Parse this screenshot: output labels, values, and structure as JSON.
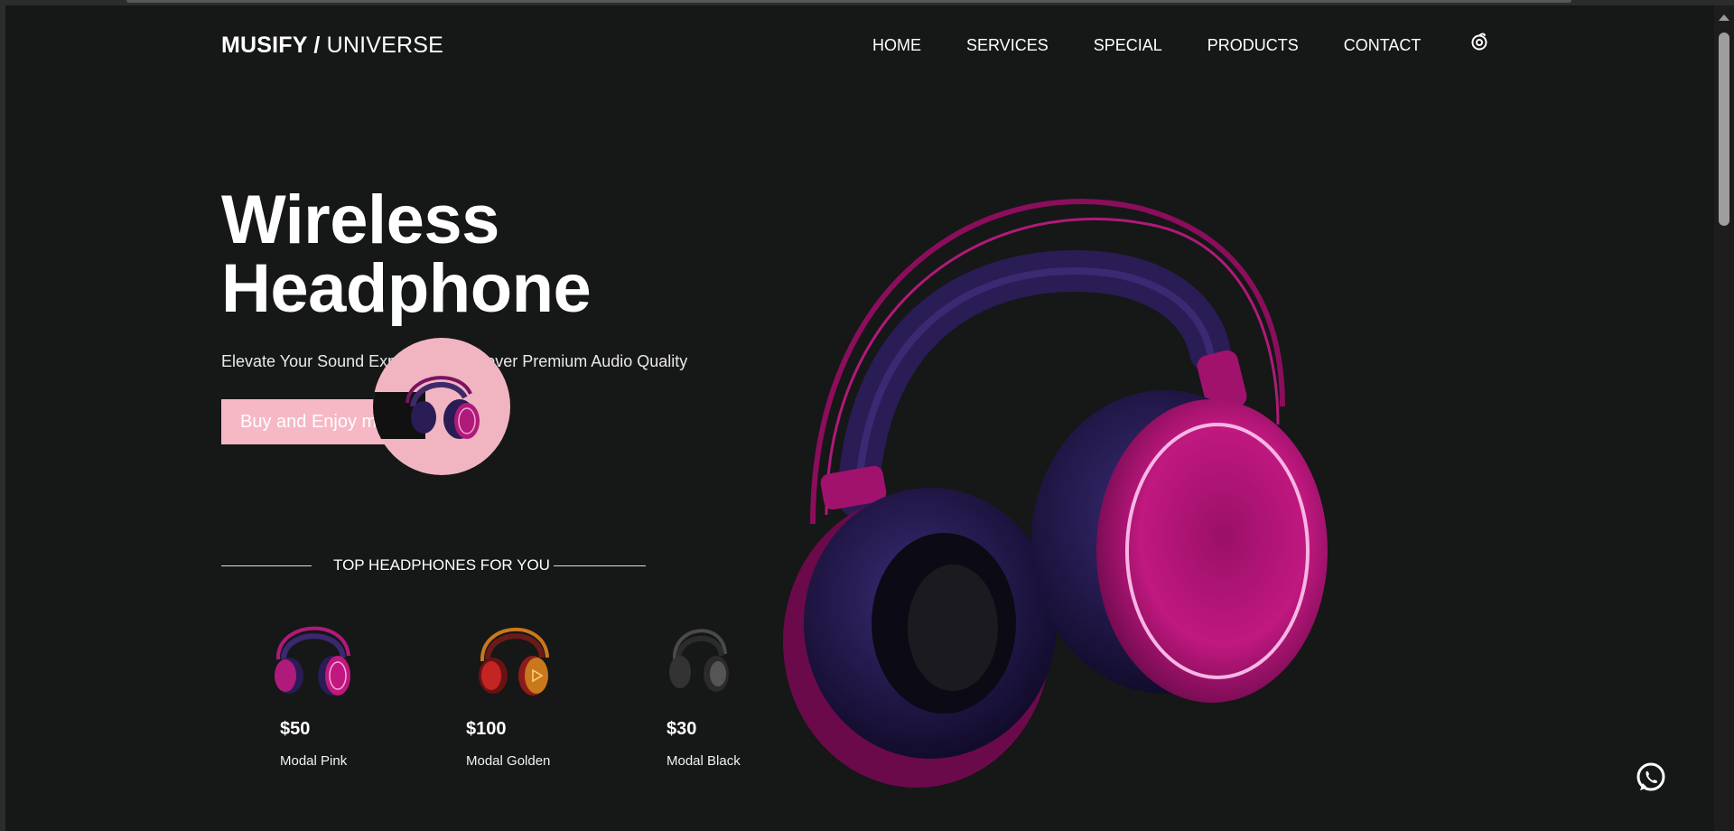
{
  "header": {
    "logo_brand": "MUSIFY",
    "logo_slash": " / ",
    "logo_sub": "UNIVERSE",
    "nav": [
      "HOME",
      "SERVICES",
      "SPECIAL",
      "PRODUCTS",
      "CONTACT"
    ],
    "icon": "swirl-icon"
  },
  "hero": {
    "title_line1": "Wireless",
    "title_line2": "Headphone",
    "subtitle": "Elevate Your Sound Experience Discover Premium Audio Quality",
    "cta_label": "Buy and Enjoy music"
  },
  "top_section": {
    "heading": "TOP HEADPHONES FOR YOU",
    "products": [
      {
        "price": "$50",
        "name": "Modal Pink",
        "color": "#b01a7a"
      },
      {
        "price": "$100",
        "name": "Modal Golden",
        "color": "#c9781b"
      },
      {
        "price": "$30",
        "name": "Modal Black",
        "color": "#3a3a3a"
      }
    ]
  },
  "colors": {
    "accent_pink": "#f6b8c5",
    "magenta": "#c0187f",
    "purple": "#2a1c55",
    "background": "#161717"
  },
  "icons": {
    "whatsapp": "whatsapp-icon"
  }
}
